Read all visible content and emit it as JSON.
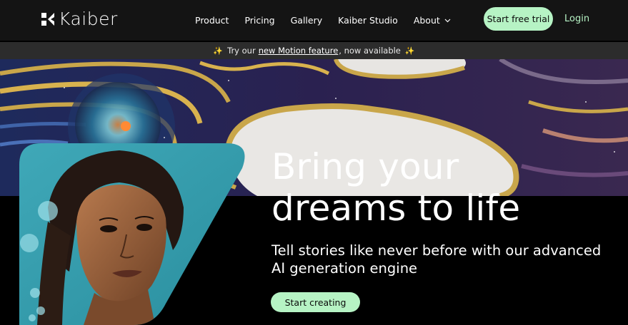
{
  "brand": {
    "name": "Kaiber"
  },
  "nav": {
    "items": [
      {
        "label": "Product"
      },
      {
        "label": "Pricing"
      },
      {
        "label": "Gallery"
      },
      {
        "label": "Kaiber Studio"
      },
      {
        "label": "About"
      }
    ],
    "trial_label": "Start free trial",
    "login_label": "Login"
  },
  "banner": {
    "prefix": "Try our",
    "link": "new Motion feature",
    "suffix": ", now available",
    "sparkle": "✨"
  },
  "hero": {
    "headline_line1": "Bring your",
    "headline_line2": "dreams to life",
    "subtitle": "Tell stories like never before with our advanced AI generation engine",
    "cta_label": "Start creating"
  },
  "colors": {
    "accent": "#b6f3c4",
    "nav_bg": "#141414",
    "banner_bg": "#2c2c2c"
  }
}
